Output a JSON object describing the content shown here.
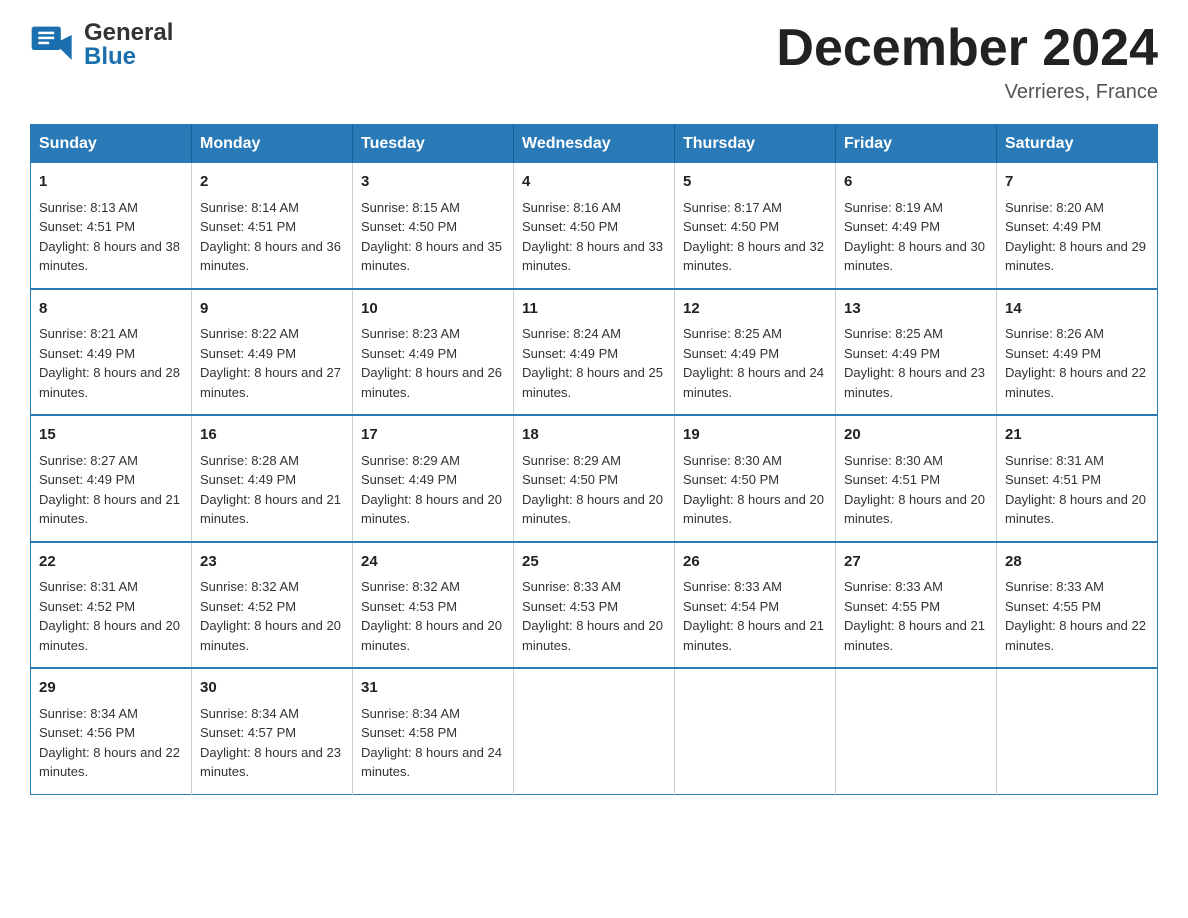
{
  "header": {
    "logo_general": "General",
    "logo_blue": "Blue",
    "month_title": "December 2024",
    "location": "Verrieres, France"
  },
  "weekdays": [
    "Sunday",
    "Monday",
    "Tuesday",
    "Wednesday",
    "Thursday",
    "Friday",
    "Saturday"
  ],
  "weeks": [
    [
      {
        "day": "1",
        "sunrise": "8:13 AM",
        "sunset": "4:51 PM",
        "daylight": "8 hours and 38 minutes."
      },
      {
        "day": "2",
        "sunrise": "8:14 AM",
        "sunset": "4:51 PM",
        "daylight": "8 hours and 36 minutes."
      },
      {
        "day": "3",
        "sunrise": "8:15 AM",
        "sunset": "4:50 PM",
        "daylight": "8 hours and 35 minutes."
      },
      {
        "day": "4",
        "sunrise": "8:16 AM",
        "sunset": "4:50 PM",
        "daylight": "8 hours and 33 minutes."
      },
      {
        "day": "5",
        "sunrise": "8:17 AM",
        "sunset": "4:50 PM",
        "daylight": "8 hours and 32 minutes."
      },
      {
        "day": "6",
        "sunrise": "8:19 AM",
        "sunset": "4:49 PM",
        "daylight": "8 hours and 30 minutes."
      },
      {
        "day": "7",
        "sunrise": "8:20 AM",
        "sunset": "4:49 PM",
        "daylight": "8 hours and 29 minutes."
      }
    ],
    [
      {
        "day": "8",
        "sunrise": "8:21 AM",
        "sunset": "4:49 PM",
        "daylight": "8 hours and 28 minutes."
      },
      {
        "day": "9",
        "sunrise": "8:22 AM",
        "sunset": "4:49 PM",
        "daylight": "8 hours and 27 minutes."
      },
      {
        "day": "10",
        "sunrise": "8:23 AM",
        "sunset": "4:49 PM",
        "daylight": "8 hours and 26 minutes."
      },
      {
        "day": "11",
        "sunrise": "8:24 AM",
        "sunset": "4:49 PM",
        "daylight": "8 hours and 25 minutes."
      },
      {
        "day": "12",
        "sunrise": "8:25 AM",
        "sunset": "4:49 PM",
        "daylight": "8 hours and 24 minutes."
      },
      {
        "day": "13",
        "sunrise": "8:25 AM",
        "sunset": "4:49 PM",
        "daylight": "8 hours and 23 minutes."
      },
      {
        "day": "14",
        "sunrise": "8:26 AM",
        "sunset": "4:49 PM",
        "daylight": "8 hours and 22 minutes."
      }
    ],
    [
      {
        "day": "15",
        "sunrise": "8:27 AM",
        "sunset": "4:49 PM",
        "daylight": "8 hours and 21 minutes."
      },
      {
        "day": "16",
        "sunrise": "8:28 AM",
        "sunset": "4:49 PM",
        "daylight": "8 hours and 21 minutes."
      },
      {
        "day": "17",
        "sunrise": "8:29 AM",
        "sunset": "4:49 PM",
        "daylight": "8 hours and 20 minutes."
      },
      {
        "day": "18",
        "sunrise": "8:29 AM",
        "sunset": "4:50 PM",
        "daylight": "8 hours and 20 minutes."
      },
      {
        "day": "19",
        "sunrise": "8:30 AM",
        "sunset": "4:50 PM",
        "daylight": "8 hours and 20 minutes."
      },
      {
        "day": "20",
        "sunrise": "8:30 AM",
        "sunset": "4:51 PM",
        "daylight": "8 hours and 20 minutes."
      },
      {
        "day": "21",
        "sunrise": "8:31 AM",
        "sunset": "4:51 PM",
        "daylight": "8 hours and 20 minutes."
      }
    ],
    [
      {
        "day": "22",
        "sunrise": "8:31 AM",
        "sunset": "4:52 PM",
        "daylight": "8 hours and 20 minutes."
      },
      {
        "day": "23",
        "sunrise": "8:32 AM",
        "sunset": "4:52 PM",
        "daylight": "8 hours and 20 minutes."
      },
      {
        "day": "24",
        "sunrise": "8:32 AM",
        "sunset": "4:53 PM",
        "daylight": "8 hours and 20 minutes."
      },
      {
        "day": "25",
        "sunrise": "8:33 AM",
        "sunset": "4:53 PM",
        "daylight": "8 hours and 20 minutes."
      },
      {
        "day": "26",
        "sunrise": "8:33 AM",
        "sunset": "4:54 PM",
        "daylight": "8 hours and 21 minutes."
      },
      {
        "day": "27",
        "sunrise": "8:33 AM",
        "sunset": "4:55 PM",
        "daylight": "8 hours and 21 minutes."
      },
      {
        "day": "28",
        "sunrise": "8:33 AM",
        "sunset": "4:55 PM",
        "daylight": "8 hours and 22 minutes."
      }
    ],
    [
      {
        "day": "29",
        "sunrise": "8:34 AM",
        "sunset": "4:56 PM",
        "daylight": "8 hours and 22 minutes."
      },
      {
        "day": "30",
        "sunrise": "8:34 AM",
        "sunset": "4:57 PM",
        "daylight": "8 hours and 23 minutes."
      },
      {
        "day": "31",
        "sunrise": "8:34 AM",
        "sunset": "4:58 PM",
        "daylight": "8 hours and 24 minutes."
      },
      null,
      null,
      null,
      null
    ]
  ],
  "labels": {
    "sunrise": "Sunrise: ",
    "sunset": "Sunset: ",
    "daylight": "Daylight: "
  }
}
